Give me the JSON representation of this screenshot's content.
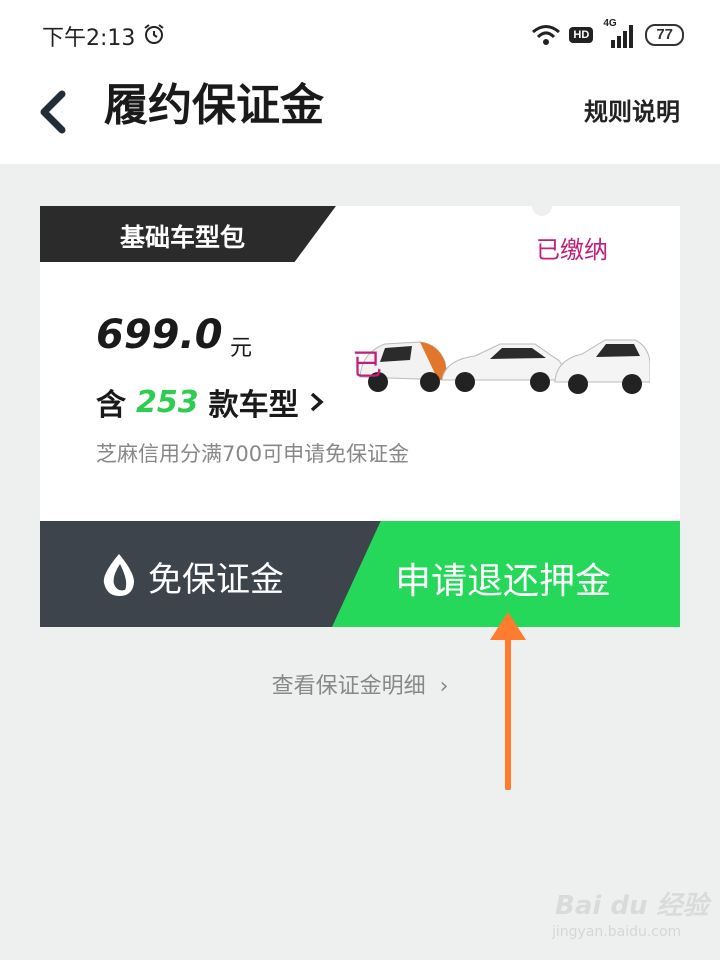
{
  "status": {
    "time": "下午2:13",
    "hd": "HD",
    "network": "4G",
    "battery": "77"
  },
  "header": {
    "title": "履约保证金",
    "rules_label": "规则说明"
  },
  "card": {
    "package_name": "基础车型包",
    "status": "已缴纳",
    "price": "699.0",
    "price_unit": "元",
    "models_prefix": "含",
    "models_count": "253",
    "models_suffix": "款车型",
    "hint": "芝麻信用分满700可申请免保证金",
    "overlay_char": "已"
  },
  "actions": {
    "free_deposit_label": "免保证金",
    "refund_label": "申请退还押金"
  },
  "detail_link": "查看保证金明细",
  "colors": {
    "accent_green": "#25d85a",
    "dark_button": "#3e444b",
    "annotation_arrow": "#ff7b2e",
    "status_magenta": "#c0207a"
  },
  "watermark": {
    "brand": "Bai du 经验",
    "url": "jingyan.baidu.com"
  }
}
